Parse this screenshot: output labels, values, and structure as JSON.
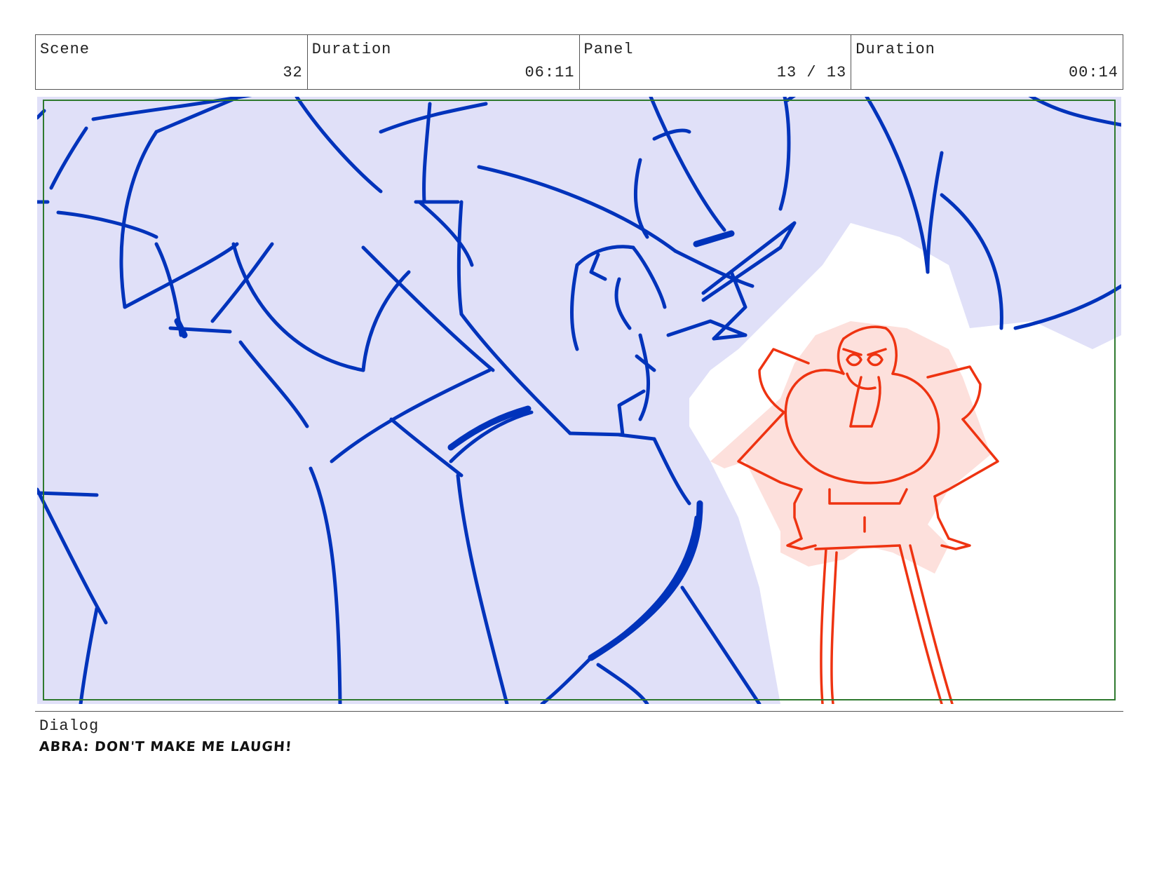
{
  "header": {
    "scene": {
      "label": "Scene",
      "value": "32"
    },
    "scene_duration": {
      "label": "Duration",
      "value": "06:11"
    },
    "panel": {
      "label": "Panel",
      "value": "13 / 13"
    },
    "panel_duration": {
      "label": "Duration",
      "value": "00:14"
    }
  },
  "dialog": {
    "label": "Dialog",
    "text": "ABRA: DON'T MAKE ME LAUGH!"
  },
  "colors": {
    "sketch_blue": "#0033bb",
    "fill_lavender": "#e0e0f8",
    "sketch_red": "#ee3311",
    "fill_pink": "#fde0dc",
    "safe_frame": "#2f7a2f"
  }
}
